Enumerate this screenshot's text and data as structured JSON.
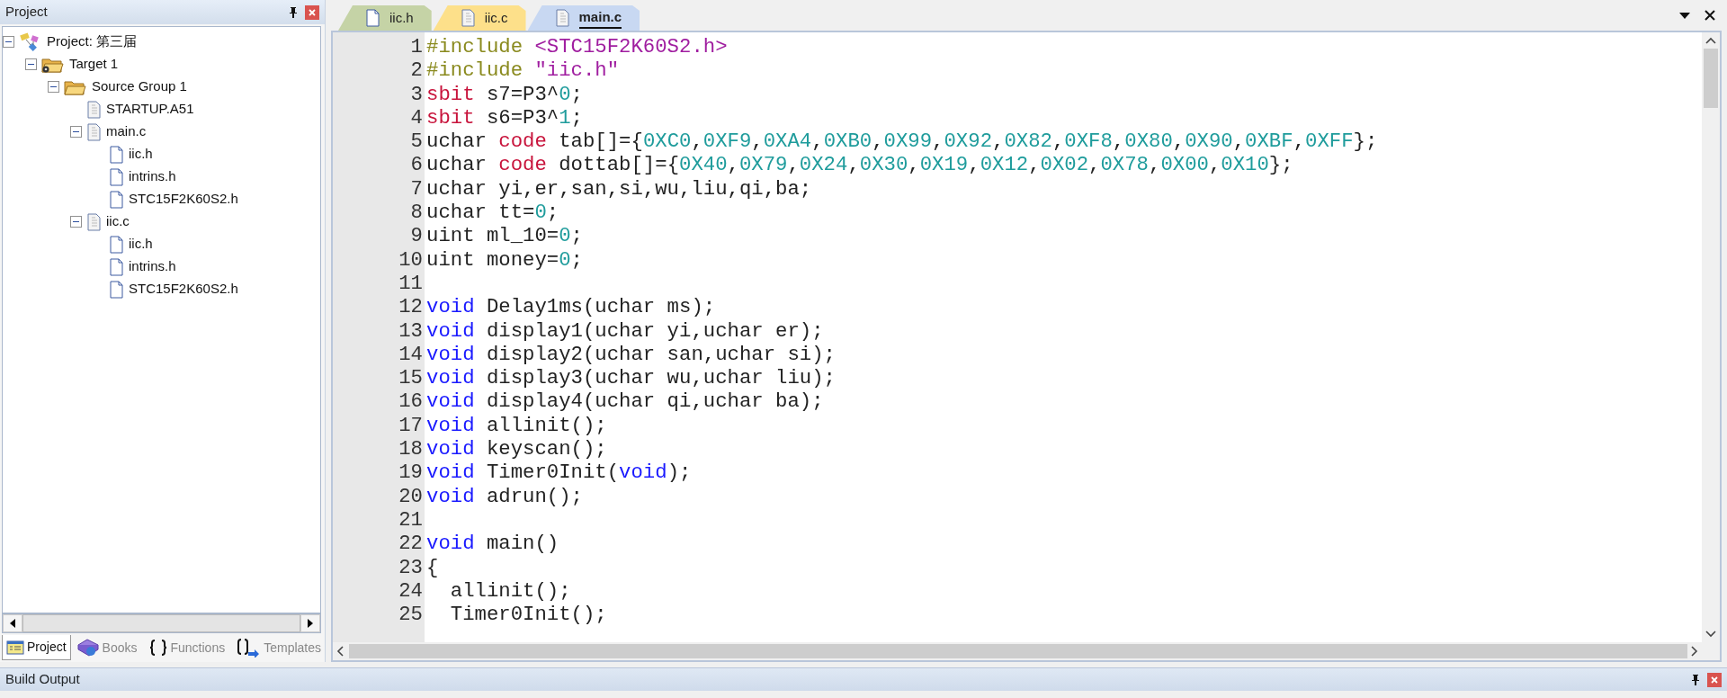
{
  "project_panel": {
    "title": "Project",
    "tree": [
      {
        "label": "Project: 第三届",
        "kind": "project",
        "expanded": true,
        "children": [
          {
            "label": "Target 1",
            "kind": "target",
            "expanded": true,
            "children": [
              {
                "label": "Source Group 1",
                "kind": "group",
                "expanded": true,
                "children": [
                  {
                    "label": "STARTUP.A51",
                    "kind": "source"
                  },
                  {
                    "label": "main.c",
                    "kind": "source",
                    "expanded": true,
                    "children": [
                      {
                        "label": "iic.h",
                        "kind": "header"
                      },
                      {
                        "label": "intrins.h",
                        "kind": "header"
                      },
                      {
                        "label": "STC15F2K60S2.h",
                        "kind": "header"
                      }
                    ]
                  },
                  {
                    "label": "iic.c",
                    "kind": "source",
                    "expanded": true,
                    "children": [
                      {
                        "label": "iic.h",
                        "kind": "header"
                      },
                      {
                        "label": "intrins.h",
                        "kind": "header"
                      },
                      {
                        "label": "STC15F2K60S2.h",
                        "kind": "header"
                      }
                    ]
                  }
                ]
              }
            ]
          }
        ]
      }
    ],
    "tabs": [
      {
        "label": "Project",
        "kind": "project",
        "selected": true
      },
      {
        "label": "Books",
        "kind": "books",
        "selected": false
      },
      {
        "label": "Functions",
        "kind": "functions",
        "selected": false
      },
      {
        "label": "Templates",
        "kind": "templates",
        "selected": false
      }
    ]
  },
  "editor": {
    "tabs": [
      {
        "label": "iic.h",
        "kind": "header",
        "color": "#c5d3a6",
        "selected": false
      },
      {
        "label": "iic.c",
        "kind": "source",
        "color": "#fde08a",
        "selected": false
      },
      {
        "label": "main.c",
        "kind": "source",
        "color": "#c8d8f2",
        "selected": true
      }
    ],
    "lines": [
      {
        "number": "1",
        "tokens": [
          {
            "kind": "preproc",
            "text": "#include "
          },
          {
            "kind": "string",
            "text": "<STC15F2K60S2.h>"
          }
        ]
      },
      {
        "number": "2",
        "tokens": [
          {
            "kind": "preproc",
            "text": "#include "
          },
          {
            "kind": "string",
            "text": "\"iic.h\""
          }
        ]
      },
      {
        "number": "3",
        "tokens": [
          {
            "kind": "type",
            "text": "sbit"
          },
          {
            "kind": "plain",
            "text": " s7=P3^"
          },
          {
            "kind": "number",
            "text": "0"
          },
          {
            "kind": "plain",
            "text": ";"
          }
        ]
      },
      {
        "number": "4",
        "tokens": [
          {
            "kind": "type",
            "text": "sbit"
          },
          {
            "kind": "plain",
            "text": " s6=P3^"
          },
          {
            "kind": "number",
            "text": "1"
          },
          {
            "kind": "plain",
            "text": ";"
          }
        ]
      },
      {
        "number": "5",
        "tokens": [
          {
            "kind": "plain",
            "text": "uchar "
          },
          {
            "kind": "type",
            "text": "code"
          },
          {
            "kind": "plain",
            "text": " tab[]={"
          },
          {
            "kind": "number",
            "text": "0XC0"
          },
          {
            "kind": "plain",
            "text": ","
          },
          {
            "kind": "number",
            "text": "0XF9"
          },
          {
            "kind": "plain",
            "text": ","
          },
          {
            "kind": "number",
            "text": "0XA4"
          },
          {
            "kind": "plain",
            "text": ","
          },
          {
            "kind": "number",
            "text": "0XB0"
          },
          {
            "kind": "plain",
            "text": ","
          },
          {
            "kind": "number",
            "text": "0X99"
          },
          {
            "kind": "plain",
            "text": ","
          },
          {
            "kind": "number",
            "text": "0X92"
          },
          {
            "kind": "plain",
            "text": ","
          },
          {
            "kind": "number",
            "text": "0X82"
          },
          {
            "kind": "plain",
            "text": ","
          },
          {
            "kind": "number",
            "text": "0XF8"
          },
          {
            "kind": "plain",
            "text": ","
          },
          {
            "kind": "number",
            "text": "0X80"
          },
          {
            "kind": "plain",
            "text": ","
          },
          {
            "kind": "number",
            "text": "0X90"
          },
          {
            "kind": "plain",
            "text": ","
          },
          {
            "kind": "number",
            "text": "0XBF"
          },
          {
            "kind": "plain",
            "text": ","
          },
          {
            "kind": "number",
            "text": "0XFF"
          },
          {
            "kind": "plain",
            "text": "};"
          }
        ]
      },
      {
        "number": "6",
        "tokens": [
          {
            "kind": "plain",
            "text": "uchar "
          },
          {
            "kind": "type",
            "text": "code"
          },
          {
            "kind": "plain",
            "text": " dottab[]={"
          },
          {
            "kind": "number",
            "text": "0X40"
          },
          {
            "kind": "plain",
            "text": ","
          },
          {
            "kind": "number",
            "text": "0X79"
          },
          {
            "kind": "plain",
            "text": ","
          },
          {
            "kind": "number",
            "text": "0X24"
          },
          {
            "kind": "plain",
            "text": ","
          },
          {
            "kind": "number",
            "text": "0X30"
          },
          {
            "kind": "plain",
            "text": ","
          },
          {
            "kind": "number",
            "text": "0X19"
          },
          {
            "kind": "plain",
            "text": ","
          },
          {
            "kind": "number",
            "text": "0X12"
          },
          {
            "kind": "plain",
            "text": ","
          },
          {
            "kind": "number",
            "text": "0X02"
          },
          {
            "kind": "plain",
            "text": ","
          },
          {
            "kind": "number",
            "text": "0X78"
          },
          {
            "kind": "plain",
            "text": ","
          },
          {
            "kind": "number",
            "text": "0X00"
          },
          {
            "kind": "plain",
            "text": ","
          },
          {
            "kind": "number",
            "text": "0X10"
          },
          {
            "kind": "plain",
            "text": "};"
          }
        ]
      },
      {
        "number": "7",
        "tokens": [
          {
            "kind": "plain",
            "text": "uchar yi,er,san,si,wu,liu,qi,ba;"
          }
        ]
      },
      {
        "number": "8",
        "tokens": [
          {
            "kind": "plain",
            "text": "uchar tt="
          },
          {
            "kind": "number",
            "text": "0"
          },
          {
            "kind": "plain",
            "text": ";"
          }
        ]
      },
      {
        "number": "9",
        "tokens": [
          {
            "kind": "plain",
            "text": "uint ml_10="
          },
          {
            "kind": "number",
            "text": "0"
          },
          {
            "kind": "plain",
            "text": ";"
          }
        ]
      },
      {
        "number": "10",
        "tokens": [
          {
            "kind": "plain",
            "text": "uint money="
          },
          {
            "kind": "number",
            "text": "0"
          },
          {
            "kind": "plain",
            "text": ";"
          }
        ]
      },
      {
        "number": "11"
      },
      {
        "number": "12",
        "tokens": [
          {
            "kind": "keyword",
            "text": "void"
          },
          {
            "kind": "plain",
            "text": " Delay1ms(uchar ms);"
          }
        ]
      },
      {
        "number": "13",
        "tokens": [
          {
            "kind": "keyword",
            "text": "void"
          },
          {
            "kind": "plain",
            "text": " display1(uchar yi,uchar er);"
          }
        ]
      },
      {
        "number": "14",
        "tokens": [
          {
            "kind": "keyword",
            "text": "void"
          },
          {
            "kind": "plain",
            "text": " display2(uchar san,uchar si);"
          }
        ]
      },
      {
        "number": "15",
        "tokens": [
          {
            "kind": "keyword",
            "text": "void"
          },
          {
            "kind": "plain",
            "text": " display3(uchar wu,uchar liu);"
          }
        ]
      },
      {
        "number": "16",
        "tokens": [
          {
            "kind": "keyword",
            "text": "void"
          },
          {
            "kind": "plain",
            "text": " display4(uchar qi,uchar ba);"
          }
        ]
      },
      {
        "number": "17",
        "tokens": [
          {
            "kind": "keyword",
            "text": "void"
          },
          {
            "kind": "plain",
            "text": " allinit();"
          }
        ]
      },
      {
        "number": "18",
        "tokens": [
          {
            "kind": "keyword",
            "text": "void"
          },
          {
            "kind": "plain",
            "text": " keyscan();"
          }
        ]
      },
      {
        "number": "19",
        "tokens": [
          {
            "kind": "keyword",
            "text": "void"
          },
          {
            "kind": "plain",
            "text": " Timer0Init("
          },
          {
            "kind": "keyword",
            "text": "void"
          },
          {
            "kind": "plain",
            "text": ");"
          }
        ]
      },
      {
        "number": "20",
        "tokens": [
          {
            "kind": "keyword",
            "text": "void"
          },
          {
            "kind": "plain",
            "text": " adrun();"
          }
        ]
      },
      {
        "number": "21"
      },
      {
        "number": "22",
        "tokens": [
          {
            "kind": "keyword",
            "text": "void"
          },
          {
            "kind": "plain",
            "text": " main()"
          }
        ]
      },
      {
        "number": "23",
        "tokens": [
          {
            "kind": "plain",
            "text": "{"
          }
        ]
      },
      {
        "number": "24",
        "tokens": [
          {
            "kind": "plain",
            "text": "  allinit();"
          }
        ]
      },
      {
        "number": "25",
        "tokens": [
          {
            "kind": "plain",
            "text": "  Timer0Init();"
          }
        ]
      }
    ]
  },
  "build_output": {
    "title": "Build Output"
  }
}
